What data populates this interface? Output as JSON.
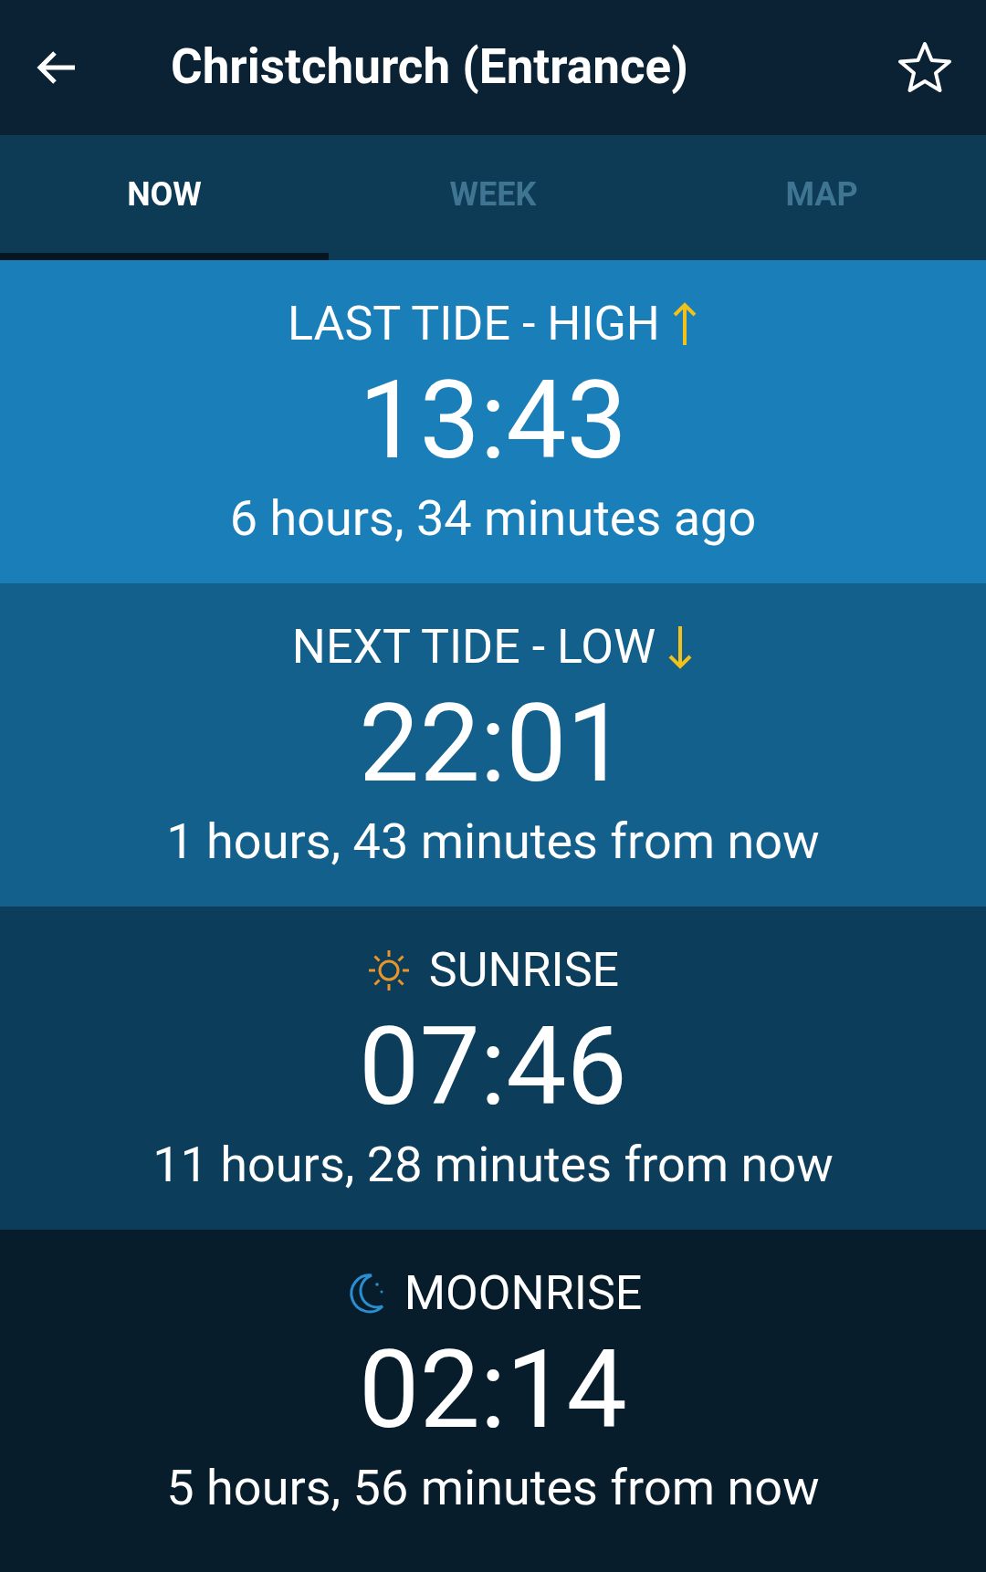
{
  "app_bar": {
    "title": "Christchurch (Entrance)",
    "favorite": false
  },
  "tabs": [
    {
      "label": "NOW",
      "selected": true
    },
    {
      "label": "WEEK",
      "selected": false
    },
    {
      "label": "MAP",
      "selected": false
    }
  ],
  "events": [
    {
      "kind": "high",
      "label": "LAST TIDE - HIGH",
      "time": "13:43",
      "relative": "6 hours, 34 minutes ago"
    },
    {
      "kind": "low",
      "label": "NEXT TIDE - LOW",
      "time": "22:01",
      "relative": "1 hours, 43 minutes from now"
    },
    {
      "kind": "sunrise",
      "label": "SUNRISE",
      "time": "07:46",
      "relative": "11 hours, 28 minutes from now"
    },
    {
      "kind": "moonrise",
      "label": "MOONRISE",
      "time": "02:14",
      "relative": "5 hours, 56 minutes from now"
    }
  ]
}
